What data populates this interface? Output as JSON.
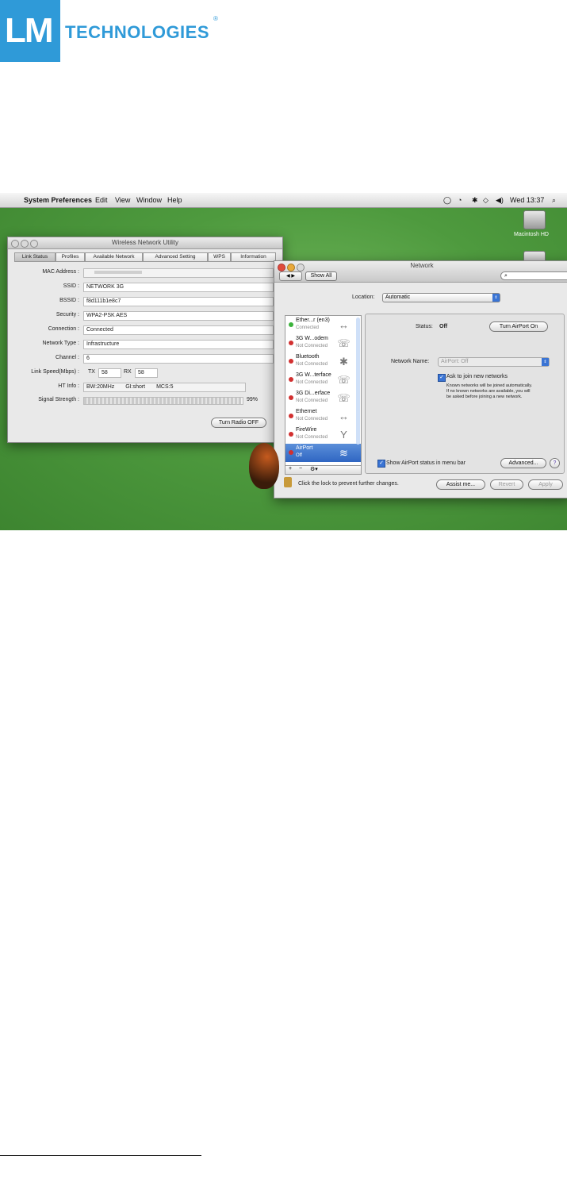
{
  "logo": {
    "mark": "LM",
    "brand": "TECHNOLOGIES",
    "registered": "®"
  },
  "menubar": {
    "apple": "",
    "app": "System Preferences",
    "items": [
      "Edit",
      "View",
      "Window",
      "Help"
    ],
    "clock": "Wed 13:37"
  },
  "desktop": {
    "disk_label": "Macintosh HD"
  },
  "wireless_utility": {
    "title": "Wireless Network Utility",
    "tabs": [
      "Link Status",
      "Profiles",
      "Available Network",
      "Advanced Setting",
      "WPS",
      "Information"
    ],
    "fields": [
      {
        "label": "MAC Address :",
        "value": ""
      },
      {
        "label": "SSID :",
        "value": "NETWORK 3G"
      },
      {
        "label": "BSSID :",
        "value": "f8d111b1e8c7"
      },
      {
        "label": "Security :",
        "value": "WPA2-PSK AES"
      },
      {
        "label": "Connection :",
        "value": "Connected"
      },
      {
        "label": "Network Type :",
        "value": "Infrastructure"
      },
      {
        "label": "Channel :",
        "value": "6"
      }
    ],
    "link_speed": {
      "label": "Link Speed(Mbps) :",
      "tx_label": "TX",
      "tx": "58",
      "rx_label": "RX",
      "rx": "58"
    },
    "ht_info": {
      "label": "HT Info :",
      "bw": "BW:20MHz",
      "gi": "GI:short",
      "mcs": "MCS:5"
    },
    "signal": {
      "label": "Signal Strength :",
      "percent_text": "99%",
      "level": 0.99
    },
    "radio_button": "Turn Radio OFF"
  },
  "network": {
    "title": "Network",
    "show_all": "Show All",
    "location_label": "Location:",
    "location_value": "Automatic",
    "services": [
      {
        "name": "Ether...r (en3)",
        "status": "Connected",
        "color": "#3cb33c",
        "icon": "↔"
      },
      {
        "name": "3G W...odem",
        "status": "Not Connected",
        "color": "#d23030",
        "icon": "☏"
      },
      {
        "name": "Bluetooth",
        "status": "Not Connected",
        "color": "#d23030",
        "icon": "✱"
      },
      {
        "name": "3G W...terface",
        "status": "Not Connected",
        "color": "#d23030",
        "icon": "☏"
      },
      {
        "name": "3G Di...erface",
        "status": "Not Connected",
        "color": "#d23030",
        "icon": "☏"
      },
      {
        "name": "Ethernet",
        "status": "Not Connected",
        "color": "#d23030",
        "icon": "↔"
      },
      {
        "name": "FireWire",
        "status": "Not Connected",
        "color": "#d23030",
        "icon": "Y"
      },
      {
        "name": "AirPort",
        "status": "Off",
        "color": "#d23030",
        "icon": "≋"
      }
    ],
    "list_controls": [
      "+",
      "−",
      "⚙▾"
    ],
    "status_label": "Status:",
    "status_value": "Off",
    "turn_airport_on": "Turn AirPort On",
    "network_name_label": "Network Name:",
    "network_name_value": "AirPort: Off",
    "ask_join": "Ask to join new networks",
    "ask_join_help_1": "Known networks will be joined automatically.",
    "ask_join_help_2": "If no known networks are available, you will",
    "ask_join_help_3": "be asked before joining a new network.",
    "show_status": "Show AirPort status in menu bar",
    "advanced": "Advanced...",
    "help": "?",
    "lock_text": "Click the lock to prevent further changes.",
    "assist": "Assist me...",
    "revert": "Revert",
    "apply": "Apply"
  }
}
